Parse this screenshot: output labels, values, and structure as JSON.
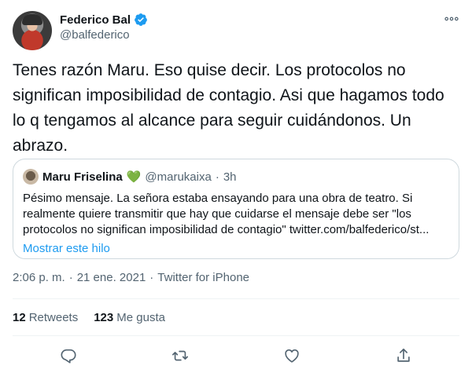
{
  "author": {
    "display_name": "Federico Bal",
    "handle": "@balfederico",
    "verified": true
  },
  "tweet": {
    "text": "Tenes razón Maru. Eso quise decir. Los protocolos no significan imposibilidad de contagio. Asi que hagamos todo lo q tengamos al alcance para seguir cuidándonos. Un abrazo."
  },
  "quoted_tweet": {
    "display_name": "Maru Friselina",
    "emoji": "💚",
    "handle": "@marukaixa",
    "separator": "·",
    "time": "3h",
    "text": "Pésimo mensaje. La señora estaba ensayando para una obra de teatro. Si realmente quiere transmitir que hay que cuidarse el mensaje debe ser \"los protocolos no significan imposibilidad de contagio\" twitter.com/balfederico/st...",
    "show_thread_label": "Mostrar este hilo"
  },
  "meta": {
    "time": "2:06 p. m.",
    "separator1": "·",
    "date": "21 ene. 2021",
    "separator2": "·",
    "source": "Twitter for iPhone"
  },
  "stats": {
    "retweets_count": "12",
    "retweets_label": "Retweets",
    "likes_count": "123",
    "likes_label": "Me gusta"
  },
  "icons": {
    "more": "more-horizontal-icon",
    "reply": "reply-icon",
    "retweet": "retweet-icon",
    "like": "heart-icon",
    "share": "share-icon",
    "verified": "verified-badge-icon"
  },
  "colors": {
    "accent": "#1d9bf0",
    "secondary_text": "#536471",
    "border": "#cfd9de"
  }
}
